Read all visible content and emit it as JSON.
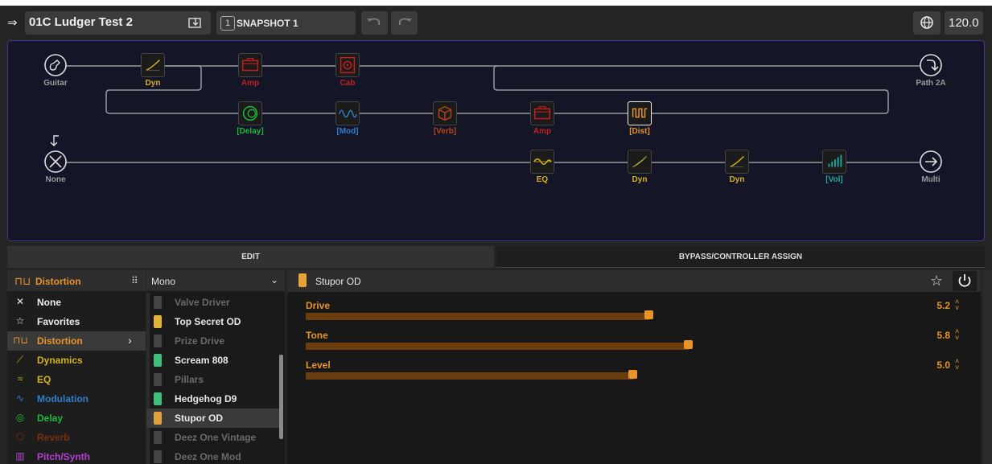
{
  "topbar": {
    "preset_name": "01C  Ludger Test 2",
    "snapshot_number": "1",
    "snapshot_label": "SNAPSHOT 1",
    "tempo": "120.0"
  },
  "grid": {
    "path1_input": "Guitar",
    "path1_output": "Path 2A",
    "path2_input": "None",
    "path2_output": "Multi",
    "blocks_row1": [
      "Dyn",
      "Amp",
      "Cab"
    ],
    "blocks_row2": [
      "[Delay]",
      "[Mod]",
      "[Verb]",
      "Amp",
      "[Dist]"
    ],
    "blocks_row3": [
      "EQ",
      "Dyn",
      "Dyn",
      "[Vol]"
    ],
    "colors": {
      "dynamics": "#d4b21e",
      "amp": "#c0201d",
      "delay": "#1fb83a",
      "modulation": "#2e7fc9",
      "reverb": "#b5461a",
      "distortion": "#e8932c",
      "volume": "#1ea8a0"
    }
  },
  "tabs": {
    "edit": "EDIT",
    "bypass": "BYPASS/CONTROLLER ASSIGN"
  },
  "categories": {
    "header": "Distortion",
    "items": [
      {
        "label": "None",
        "icon": "x-icon",
        "color": "#eeeeee"
      },
      {
        "label": "Favorites",
        "icon": "star-icon",
        "color": "#eeeeee"
      },
      {
        "label": "Distortion",
        "icon": "distortion-icon",
        "color": "#e8932c"
      },
      {
        "label": "Dynamics",
        "icon": "dynamics-icon",
        "color": "#d4b21e"
      },
      {
        "label": "EQ",
        "icon": "eq-icon",
        "color": "#d4b21e"
      },
      {
        "label": "Modulation",
        "icon": "modulation-icon",
        "color": "#2e7fc9"
      },
      {
        "label": "Delay",
        "icon": "delay-icon",
        "color": "#1fb83a"
      },
      {
        "label": "Reverb",
        "icon": "reverb-icon",
        "color": "#7a2e12"
      },
      {
        "label": "Pitch/Synth",
        "icon": "pitch-icon",
        "color": "#b23fd6"
      }
    ]
  },
  "models": {
    "mode": "Mono",
    "items": [
      {
        "label": "Valve Driver",
        "dim": true
      },
      {
        "label": "Top Secret OD",
        "dim": false
      },
      {
        "label": "Prize Drive",
        "dim": true
      },
      {
        "label": "Scream 808",
        "dim": false
      },
      {
        "label": "Pillars",
        "dim": true
      },
      {
        "label": "Hedgehog D9",
        "dim": false
      },
      {
        "label": "Stupor OD",
        "dim": false
      },
      {
        "label": "Deez One Vintage",
        "dim": true
      },
      {
        "label": "Deez One Mod",
        "dim": true
      }
    ]
  },
  "params": {
    "model_name": "Stupor OD",
    "list": [
      {
        "name": "Drive",
        "value": "5.2",
        "fill": 0.86
      },
      {
        "name": "Tone",
        "value": "5.8",
        "fill": 0.96
      },
      {
        "name": "Level",
        "value": "5.0",
        "fill": 0.82
      }
    ]
  }
}
